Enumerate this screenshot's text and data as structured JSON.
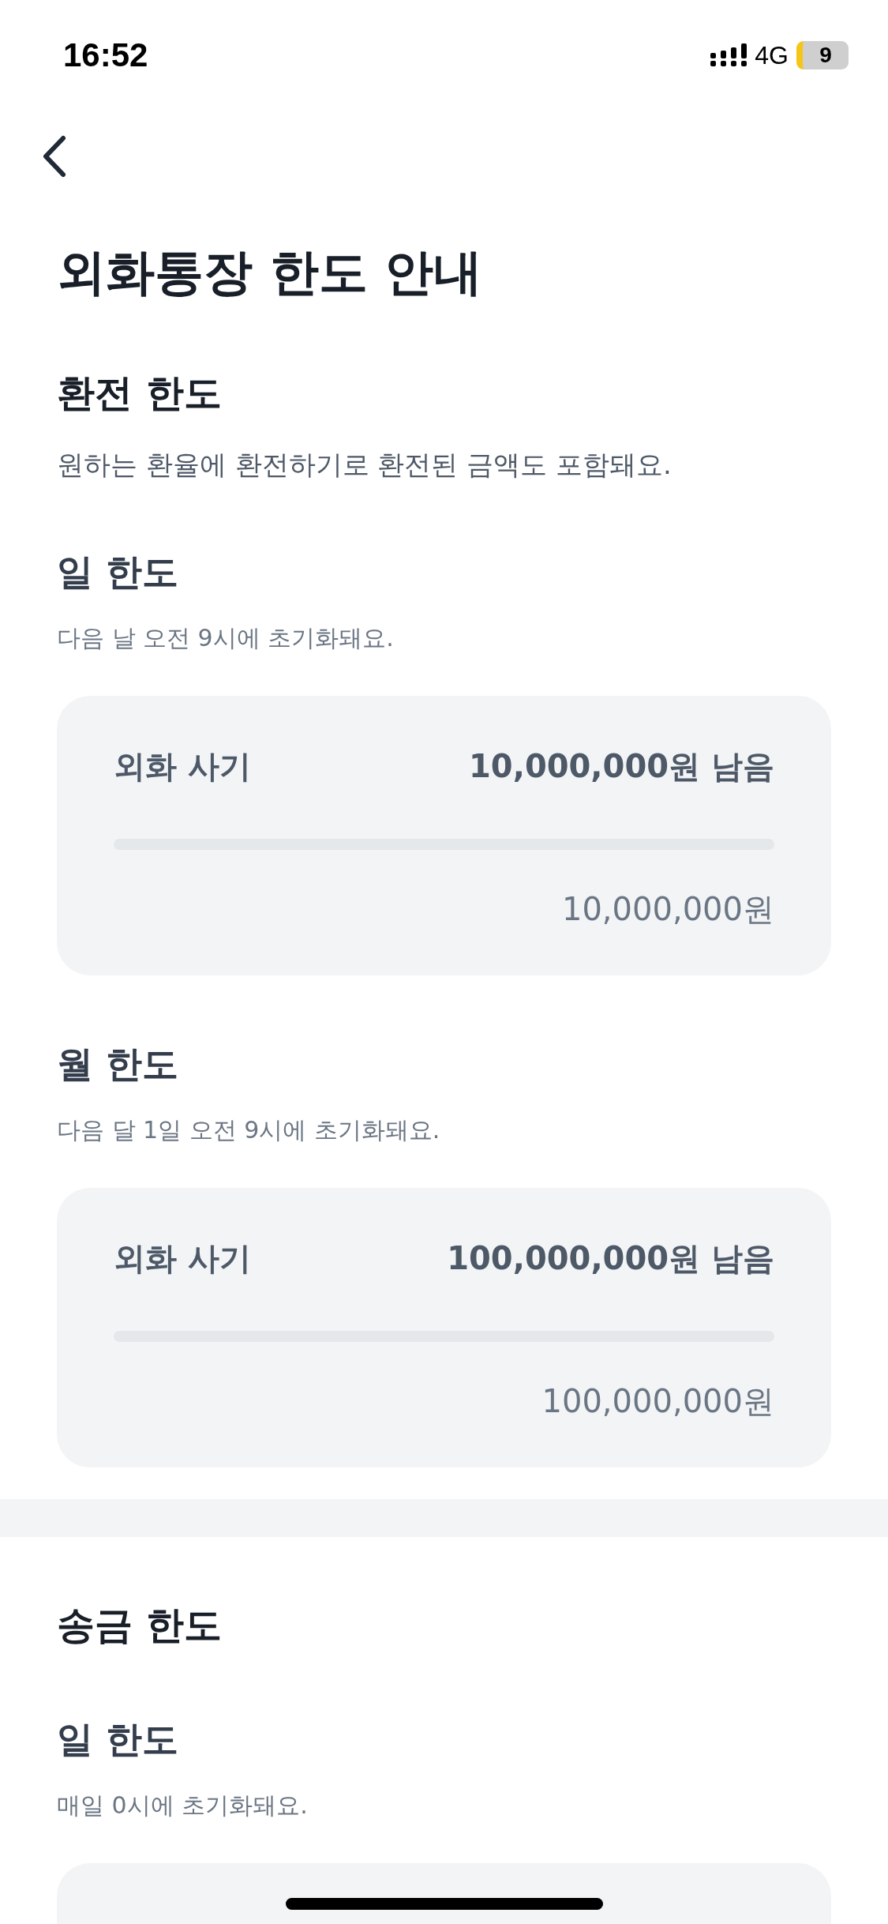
{
  "status_bar": {
    "time": "16:52",
    "network": "4G",
    "battery": "9"
  },
  "title": "외화통장 한도 안내",
  "sections": [
    {
      "heading": "환전 한도",
      "description": "원하는 환율에 환전하기로 환전된 금액도 포함돼요.",
      "periods": [
        {
          "heading": "일 한도",
          "description": "다음 날 오전 9시에 초기화돼요.",
          "card": {
            "label": "외화 사기",
            "remaining": "10,000,000원 남음",
            "level": 0,
            "total": "10,000,000원"
          }
        },
        {
          "heading": "월 한도",
          "description": "다음 달 1일 오전 9시에 초기화돼요.",
          "card": {
            "label": "외화 사기",
            "remaining": "100,000,000원 남음",
            "level": 0,
            "total": "100,000,000원"
          }
        }
      ]
    },
    {
      "heading": "송금 한도",
      "periods": [
        {
          "heading": "일 한도",
          "description": "매일 0시에 초기화돼요."
        }
      ]
    }
  ]
}
